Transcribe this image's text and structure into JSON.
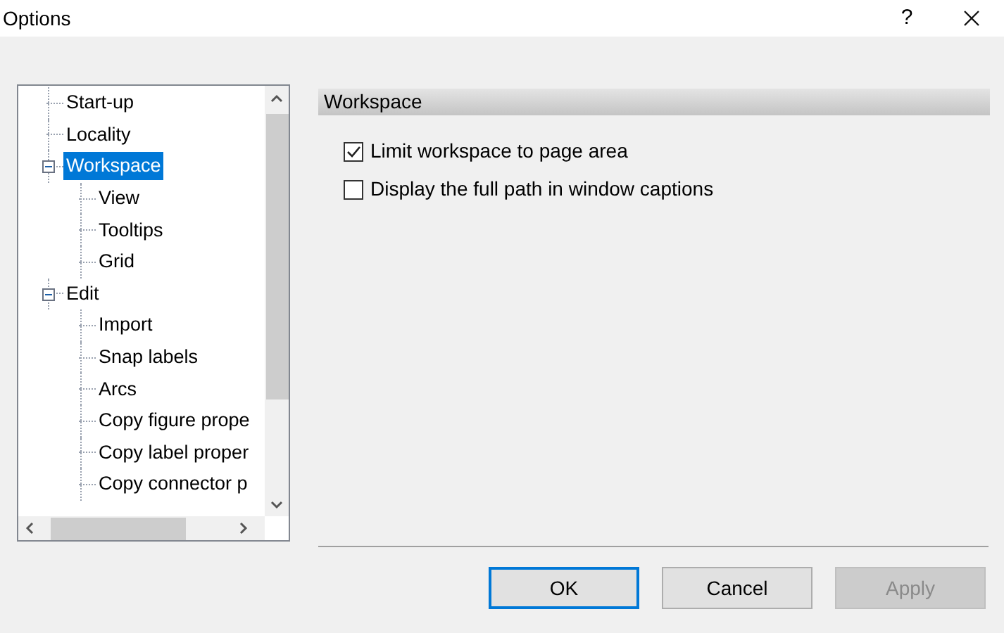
{
  "window": {
    "title": "Options",
    "help": "?"
  },
  "tree": [
    {
      "label": "Start-up",
      "selected": false
    },
    {
      "label": "Locality",
      "selected": false
    },
    {
      "label": "Workspace",
      "selected": true,
      "expanded": true,
      "children": [
        {
          "label": "View",
          "selected": false
        },
        {
          "label": "Tooltips",
          "selected": false
        },
        {
          "label": "Grid",
          "selected": false
        }
      ]
    },
    {
      "label": "Edit",
      "selected": false,
      "expanded": true,
      "children": [
        {
          "label": "Import",
          "selected": false
        },
        {
          "label": "Snap labels",
          "selected": false
        },
        {
          "label": "Arcs",
          "selected": false
        },
        {
          "label": "Copy figure prope",
          "selected": false
        },
        {
          "label": "Copy label proper",
          "selected": false
        },
        {
          "label": "Copy connector p",
          "selected": false
        }
      ]
    }
  ],
  "panel": {
    "title": "Workspace",
    "options": [
      {
        "label": "Limit workspace to page area",
        "checked": true
      },
      {
        "label": "Display the full path in window captions",
        "checked": false
      }
    ]
  },
  "buttons": [
    {
      "label": "OK",
      "kind": "default",
      "disabled": false
    },
    {
      "label": "Cancel",
      "kind": "normal",
      "disabled": false
    },
    {
      "label": "Apply",
      "kind": "normal",
      "disabled": true
    }
  ]
}
